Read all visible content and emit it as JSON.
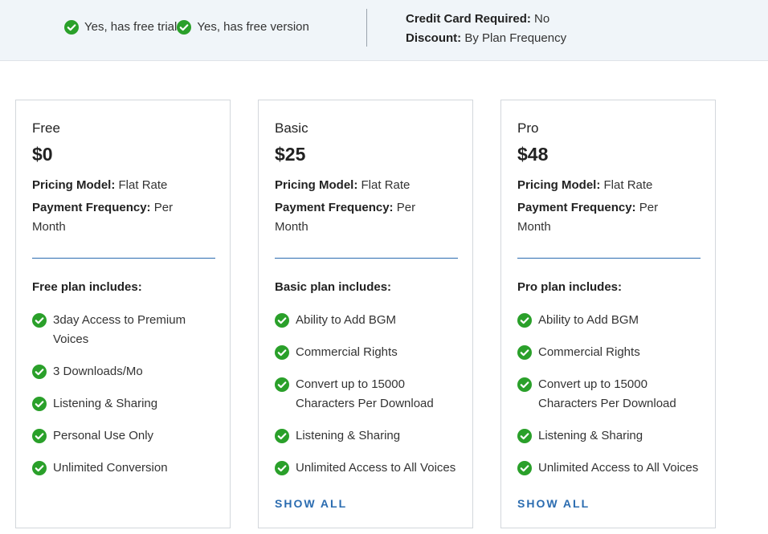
{
  "header": {
    "free_trial": "Yes, has free trial",
    "free_version": "Yes, has free version",
    "credit_card_label": "Credit Card Required:",
    "credit_card_value": "No",
    "discount_label": "Discount:",
    "discount_value": "By Plan Frequency"
  },
  "labels": {
    "pricing_model": "Pricing Model:",
    "payment_frequency": "Payment Frequency:"
  },
  "colors": {
    "check_green": "#2aa02a",
    "accent_blue": "#2b6cb0"
  },
  "icons": {
    "check": "check-circle-icon"
  },
  "plans": [
    {
      "name": "Free",
      "price": "$0",
      "pricing_model": "Flat Rate",
      "payment_frequency": "Per Month",
      "includes_title": "Free plan includes:",
      "features": [
        "3day Access to Premium Voices",
        "3 Downloads/Mo",
        "Listening & Sharing",
        "Personal Use Only",
        "Unlimited Conversion"
      ],
      "show_all": ""
    },
    {
      "name": "Basic",
      "price": "$25",
      "pricing_model": "Flat Rate",
      "payment_frequency": "Per Month",
      "includes_title": "Basic plan includes:",
      "features": [
        "Ability to Add BGM",
        "Commercial Rights",
        "Convert up to 15000 Characters Per Download",
        "Listening & Sharing",
        "Unlimited Access to All Voices"
      ],
      "show_all": "SHOW ALL"
    },
    {
      "name": "Pro",
      "price": "$48",
      "pricing_model": "Flat Rate",
      "payment_frequency": "Per Month",
      "includes_title": "Pro plan includes:",
      "features": [
        "Ability to Add BGM",
        "Commercial Rights",
        "Convert up to 15000 Characters Per Download",
        "Listening & Sharing",
        "Unlimited Access to All Voices"
      ],
      "show_all": "SHOW ALL"
    }
  ]
}
